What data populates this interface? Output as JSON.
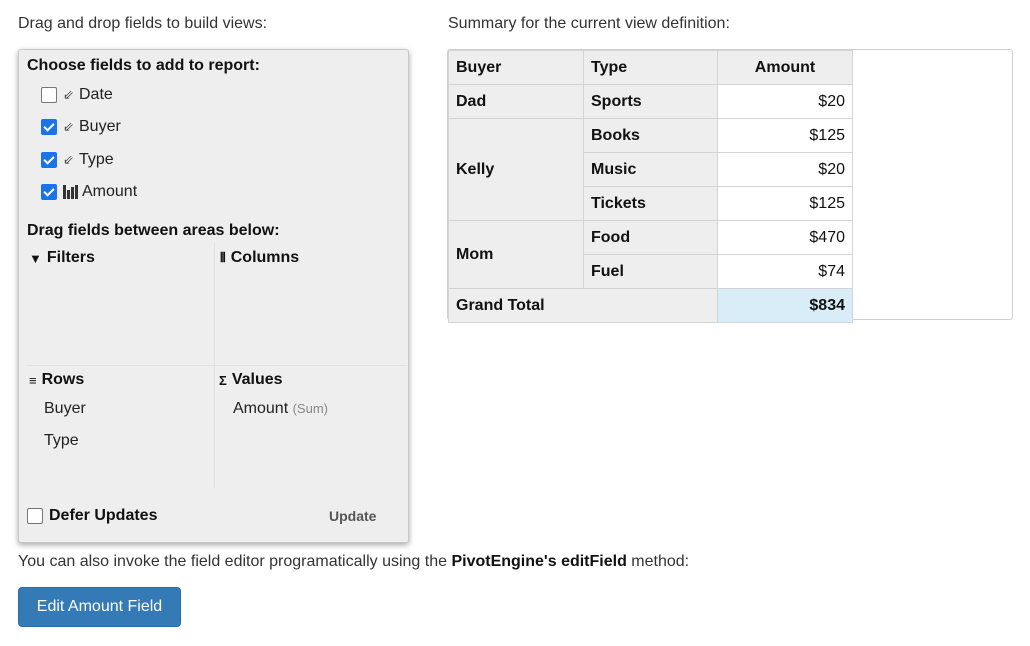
{
  "captions": {
    "left": "Drag and drop fields to build views:",
    "right": "Summary for the current view definition:"
  },
  "field_editor": {
    "choose_heading": "Choose fields to add to report:",
    "fields": [
      {
        "label": "Date",
        "checked": false,
        "icon": "dimension-icon"
      },
      {
        "label": "Buyer",
        "checked": true,
        "icon": "dimension-icon"
      },
      {
        "label": "Type",
        "checked": true,
        "icon": "dimension-icon"
      },
      {
        "label": "Amount",
        "checked": true,
        "icon": "measure-icon"
      }
    ],
    "drag_heading": "Drag fields between areas below:",
    "areas": {
      "filters": {
        "label": "Filters",
        "icon": "filter-icon"
      },
      "columns": {
        "label": "Columns",
        "icon": "columns-icon"
      },
      "rows": {
        "label": "Rows",
        "icon": "rows-icon",
        "items": [
          "Buyer",
          "Type"
        ]
      },
      "values": {
        "label": "Values",
        "icon": "sigma-icon",
        "items": [
          {
            "name": "Amount",
            "agg": "(Sum)"
          }
        ]
      }
    },
    "defer_label": "Defer Updates",
    "defer_checked": false,
    "update_label": "Update"
  },
  "grid": {
    "headers": {
      "buyer": "Buyer",
      "type": "Type",
      "amount": "Amount"
    },
    "groups": [
      {
        "buyer": "Dad",
        "rows": [
          {
            "type": "Sports",
            "amount": "$20"
          }
        ]
      },
      {
        "buyer": "Kelly",
        "rows": [
          {
            "type": "Books",
            "amount": "$125"
          },
          {
            "type": "Music",
            "amount": "$20"
          },
          {
            "type": "Tickets",
            "amount": "$125"
          }
        ]
      },
      {
        "buyer": "Mom",
        "rows": [
          {
            "type": "Food",
            "amount": "$470"
          },
          {
            "type": "Fuel",
            "amount": "$74"
          }
        ]
      }
    ],
    "grand_total_label": "Grand Total",
    "grand_total": "$834"
  },
  "bottom": {
    "text_prefix": "You can also invoke the field editor programatically using the ",
    "bold1": "PivotEngine's",
    "space": " ",
    "bold2": "editField",
    "text_suffix": " method:"
  },
  "edit_button_label": "Edit Amount Field",
  "colors": {
    "button": "#337ab7",
    "checkbox": "#1a73e8",
    "grand_total_bg": "#d8edf7"
  }
}
